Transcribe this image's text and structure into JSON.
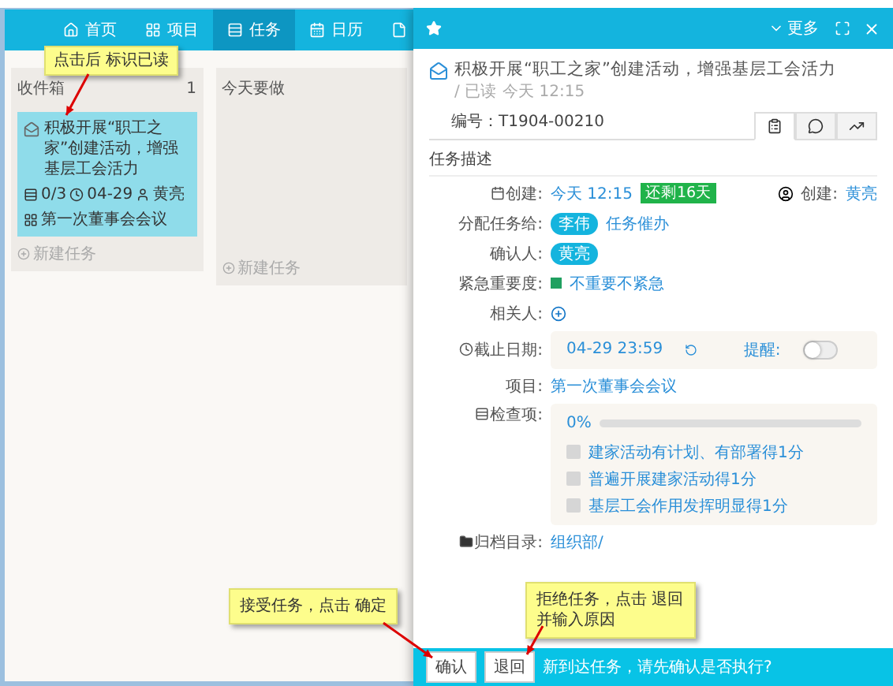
{
  "nav": {
    "tabs": [
      {
        "label": "首页",
        "selected": false
      },
      {
        "label": "项目",
        "selected": false
      },
      {
        "label": "任务",
        "selected": true
      },
      {
        "label": "日历",
        "selected": false
      },
      {
        "selected": false
      }
    ]
  },
  "columns": [
    {
      "title": "收件箱",
      "count": "1",
      "cards": [
        {
          "title": "积极开展“职工之家”创建活动，增强基层工会活力",
          "checklist": "0/3",
          "date": "04-29",
          "person": "黄亮",
          "project": "第一次董事会会议"
        }
      ],
      "add_label": "新建任务"
    },
    {
      "title": "今天要做",
      "add_label": "新建任务"
    }
  ],
  "detail": {
    "more": "更多",
    "title": "积极开展“职工之家”创建活动，增强基层工会活力",
    "status": "/ 已读",
    "time": "今天 12:15",
    "number": "编号：T1904-00210",
    "view_tabs": [
      {
        "selected": true
      },
      {
        "selected": false
      },
      {
        "selected": false
      }
    ],
    "section": "任务描述",
    "created_label": "创建:",
    "created_time": "今天 12:15",
    "remaining": "还剩16天",
    "creator_label": "创建:",
    "creator": "黄亮",
    "assign_label": "分配任务给:",
    "assignee": "李伟",
    "urge": "任务催办",
    "confirmer_label": "确认人:",
    "confirmer": "黄亮",
    "priority_label": "紧急重要度:",
    "priority": "不重要不紧急",
    "related_label": "相关人:",
    "deadline_label": "截止日期:",
    "deadline": "04-29 23:59",
    "remind_label": "提醒:",
    "remind_on": false,
    "project_label": "项目:",
    "project": "第一次董事会会议",
    "checklist_label": "检查项:",
    "progress": "0%",
    "level": 0,
    "checklist": [
      {
        "text": "建家活动有计划、有部署得1分",
        "checked": false
      },
      {
        "text": "普遍开展建家活动得1分",
        "checked": false
      },
      {
        "text": "基层工会作用发挥明显得1分",
        "checked": false
      }
    ],
    "archive_label": "归档目录:",
    "archive": "组织部/"
  },
  "footer": {
    "buttons": [
      "确认",
      "退回"
    ],
    "message": "新到达任务，请先确认是否执行?"
  },
  "callouts": [
    {
      "text": "点击后 标识已读"
    },
    {
      "text": "接受任务，点击 确定"
    },
    {
      "text": "拒绝任务，点击 退回并输入原因"
    }
  ]
}
